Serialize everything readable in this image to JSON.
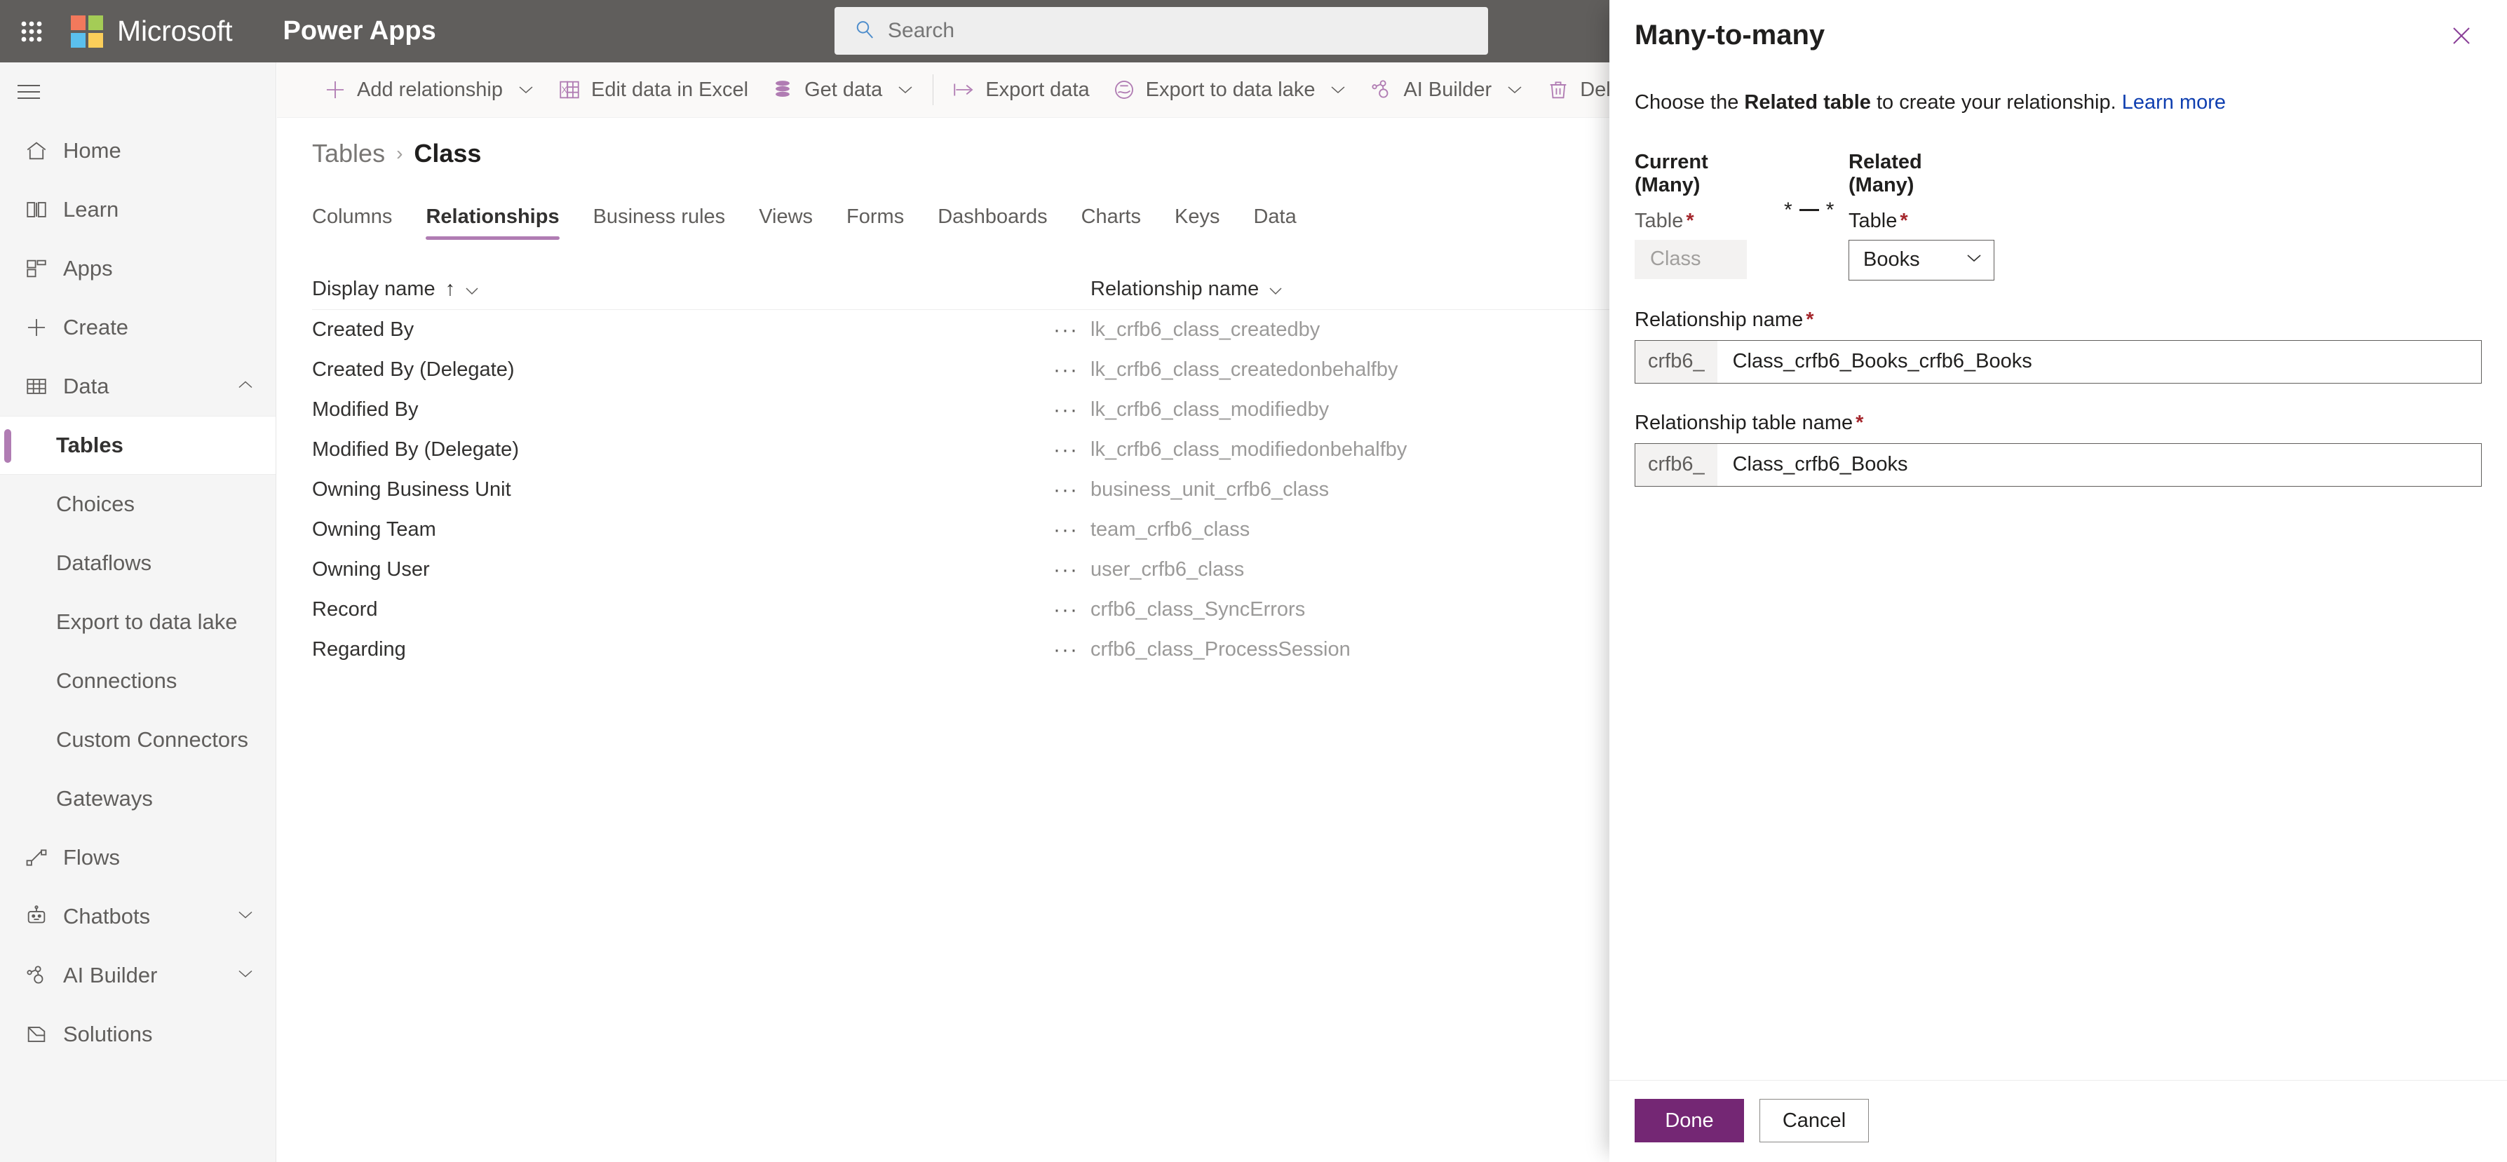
{
  "topbar": {
    "waffle_icon": "app-launcher-icon",
    "brand": "Microsoft",
    "app_name": "Power Apps",
    "search_placeholder": "Search",
    "search_value": "",
    "search_icon": "search-icon",
    "bg_color": "#605e5c"
  },
  "sidebar": {
    "hamburger_icon": "hamburger-menu-icon",
    "accent_color": "#b07cb3",
    "items": [
      {
        "label": "Home",
        "icon": "home-icon",
        "level": "top",
        "selected": false,
        "chevron": ""
      },
      {
        "label": "Learn",
        "icon": "book-icon",
        "level": "top",
        "selected": false,
        "chevron": ""
      },
      {
        "label": "Apps",
        "icon": "apps-grid-icon",
        "level": "top",
        "selected": false,
        "chevron": ""
      },
      {
        "label": "Create",
        "icon": "plus-icon",
        "level": "top",
        "selected": false,
        "chevron": ""
      },
      {
        "label": "Data",
        "icon": "table-grid-icon",
        "level": "top",
        "selected": false,
        "chevron": "chevron-up-icon"
      },
      {
        "label": "Tables",
        "icon": "",
        "level": "sub",
        "selected": true,
        "chevron": ""
      },
      {
        "label": "Choices",
        "icon": "",
        "level": "sub",
        "selected": false,
        "chevron": ""
      },
      {
        "label": "Dataflows",
        "icon": "",
        "level": "sub",
        "selected": false,
        "chevron": ""
      },
      {
        "label": "Export to data lake",
        "icon": "",
        "level": "sub",
        "selected": false,
        "chevron": ""
      },
      {
        "label": "Connections",
        "icon": "",
        "level": "sub",
        "selected": false,
        "chevron": ""
      },
      {
        "label": "Custom Connectors",
        "icon": "",
        "level": "sub",
        "selected": false,
        "chevron": ""
      },
      {
        "label": "Gateways",
        "icon": "",
        "level": "sub",
        "selected": false,
        "chevron": ""
      },
      {
        "label": "Flows",
        "icon": "flow-icon",
        "level": "top",
        "selected": false,
        "chevron": ""
      },
      {
        "label": "Chatbots",
        "icon": "robot-icon",
        "level": "top",
        "selected": false,
        "chevron": "chevron-down-icon"
      },
      {
        "label": "AI Builder",
        "icon": "ai-builder-icon",
        "level": "top",
        "selected": false,
        "chevron": "chevron-down-icon"
      },
      {
        "label": "Solutions",
        "icon": "solutions-icon",
        "level": "top",
        "selected": false,
        "chevron": ""
      }
    ]
  },
  "commandbar": {
    "accent_color": "#b07cb3",
    "items": [
      {
        "label": "Add relationship",
        "icon": "plus-icon",
        "chevron": true,
        "sep_after": false
      },
      {
        "label": "Edit data in Excel",
        "icon": "excel-icon",
        "chevron": false,
        "sep_after": false
      },
      {
        "label": "Get data",
        "icon": "database-icon",
        "chevron": true,
        "sep_after": true
      },
      {
        "label": "Export data",
        "icon": "export-arrow-icon",
        "chevron": false,
        "sep_after": false
      },
      {
        "label": "Export to data lake",
        "icon": "data-lake-icon",
        "chevron": true,
        "sep_after": false
      },
      {
        "label": "AI Builder",
        "icon": "ai-builder-icon",
        "chevron": true,
        "sep_after": false
      },
      {
        "label": "Delete table",
        "icon": "trash-icon",
        "chevron": false,
        "sep_after": false
      }
    ]
  },
  "breadcrumb": {
    "parent": "Tables",
    "separator": "›",
    "current": "Class"
  },
  "tabs": [
    {
      "label": "Columns",
      "active": false
    },
    {
      "label": "Relationships",
      "active": true
    },
    {
      "label": "Business rules",
      "active": false
    },
    {
      "label": "Views",
      "active": false
    },
    {
      "label": "Forms",
      "active": false
    },
    {
      "label": "Dashboards",
      "active": false
    },
    {
      "label": "Charts",
      "active": false
    },
    {
      "label": "Keys",
      "active": false
    },
    {
      "label": "Data",
      "active": false
    }
  ],
  "grid": {
    "columns": [
      {
        "label": "Display name",
        "sort": "↑",
        "chevron": "chevron-down-icon"
      },
      {
        "label": "Relationship name",
        "sort": "",
        "chevron": "chevron-down-icon"
      }
    ],
    "rows": [
      {
        "display_name": "Created By",
        "menu": "···",
        "relationship_name": "lk_crfb6_class_createdby"
      },
      {
        "display_name": "Created By (Delegate)",
        "menu": "···",
        "relationship_name": "lk_crfb6_class_createdonbehalfby"
      },
      {
        "display_name": "Modified By",
        "menu": "···",
        "relationship_name": "lk_crfb6_class_modifiedby"
      },
      {
        "display_name": "Modified By (Delegate)",
        "menu": "···",
        "relationship_name": "lk_crfb6_class_modifiedonbehalfby"
      },
      {
        "display_name": "Owning Business Unit",
        "menu": "···",
        "relationship_name": "business_unit_crfb6_class"
      },
      {
        "display_name": "Owning Team",
        "menu": "···",
        "relationship_name": "team_crfb6_class"
      },
      {
        "display_name": "Owning User",
        "menu": "···",
        "relationship_name": "user_crfb6_class"
      },
      {
        "display_name": "Record",
        "menu": "···",
        "relationship_name": "crfb6_class_SyncErrors"
      },
      {
        "display_name": "Regarding",
        "menu": "···",
        "relationship_name": "crfb6_class_ProcessSession"
      }
    ]
  },
  "panel": {
    "title": "Many-to-many",
    "close_icon": "close-icon",
    "desc_prefix": "Choose the ",
    "desc_bold": "Related table",
    "desc_suffix": " to create your relationship. ",
    "learn_more": "Learn more",
    "current": {
      "section_title": "Current (Many)",
      "field_label": "Table",
      "required": "*",
      "value": "Class"
    },
    "cardinality": {
      "left": "*",
      "right": "*"
    },
    "related": {
      "section_title": "Related (Many)",
      "field_label": "Table",
      "required": "*",
      "value": "Books",
      "chevron": "chevron-down-icon"
    },
    "relationship_name": {
      "label": "Relationship name",
      "required": "*",
      "prefix": "crfb6_",
      "value": "Class_crfb6_Books_crfb6_Books"
    },
    "relationship_table_name": {
      "label": "Relationship table name",
      "required": "*",
      "prefix": "crfb6_",
      "value": "Class_crfb6_Books"
    },
    "footer": {
      "done": "Done",
      "cancel": "Cancel",
      "primary_color": "#742774"
    }
  }
}
